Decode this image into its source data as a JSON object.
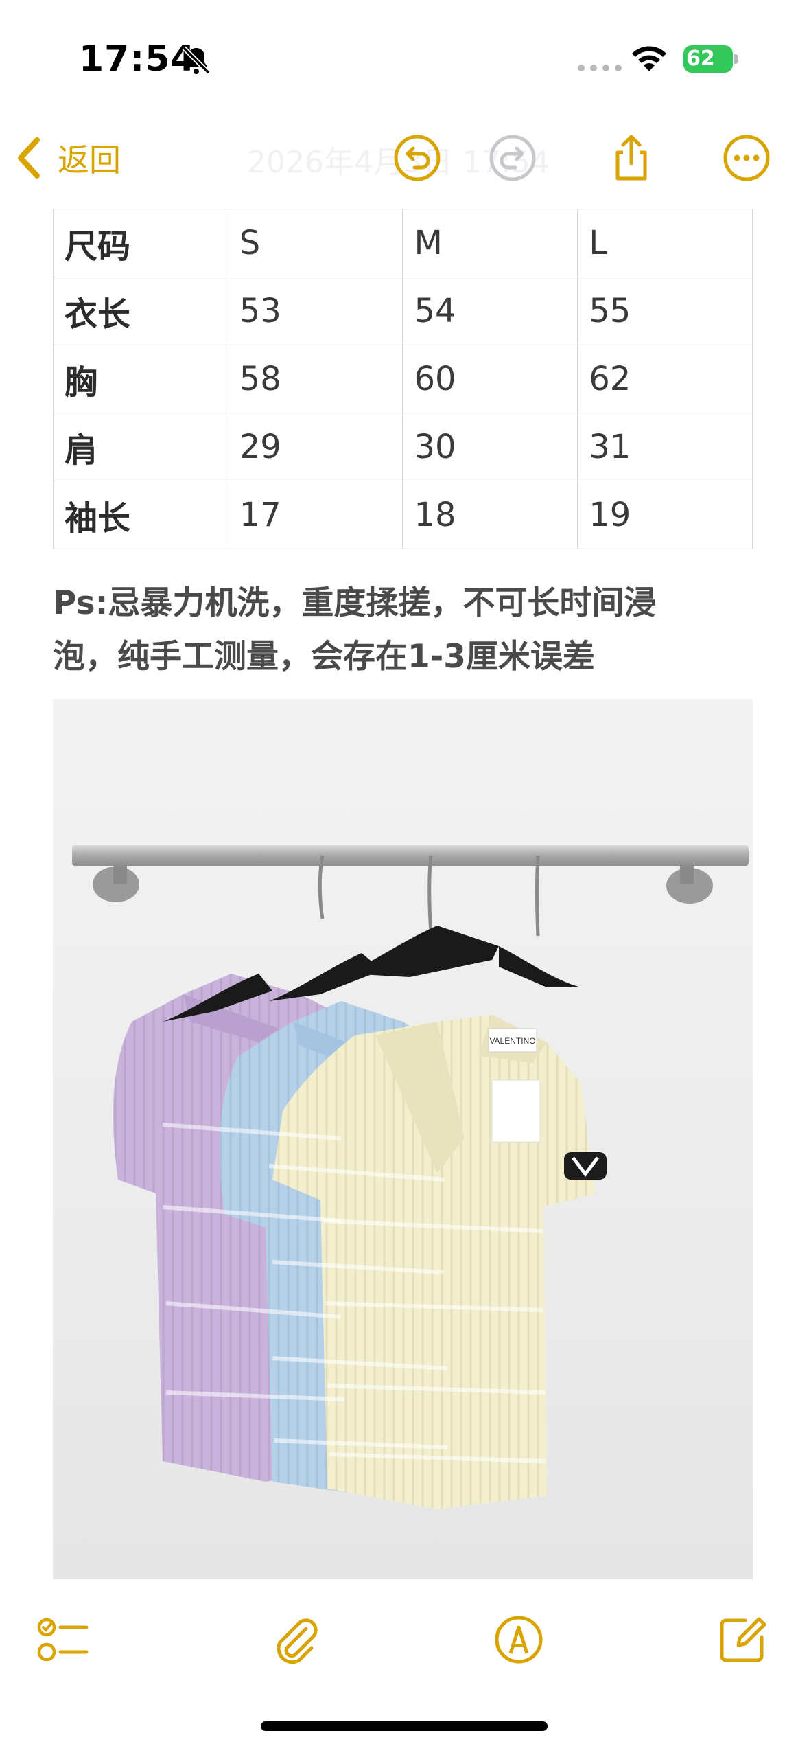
{
  "status_bar": {
    "time": "17:54",
    "battery_level": "62",
    "icons": [
      "bell-slash-icon",
      "signal-dots-icon",
      "wifi-icon",
      "battery-icon"
    ]
  },
  "nav": {
    "back_label": "返回",
    "date_title": "2026年4月3日 17:54",
    "icons": [
      "chevron-left-icon",
      "undo-icon",
      "redo-icon",
      "share-icon",
      "more-icon"
    ],
    "accent_color": "#d9a400"
  },
  "size_table": {
    "rows": [
      [
        "尺码",
        "S",
        "M",
        "L"
      ],
      [
        "衣长",
        "53",
        "54",
        "55"
      ],
      [
        "胸",
        "58",
        "60",
        "62"
      ],
      [
        "肩",
        "29",
        "30",
        "31"
      ],
      [
        "袖长",
        "17",
        "18",
        "19"
      ]
    ]
  },
  "note": {
    "line1": "Ps:忌暴力机洗，重度揉搓，不可长时间浸",
    "line2": "泡，纯手工测量，会存在1-3厘米误差"
  },
  "photo": {
    "label_text": "VALENTINO",
    "garment_colors": [
      "#c9b3dc",
      "#b5d1ea",
      "#f3efcd"
    ]
  },
  "toolbar": {
    "icons": [
      "checklist-icon",
      "paperclip-icon",
      "markup-pen-icon",
      "compose-icon"
    ]
  }
}
